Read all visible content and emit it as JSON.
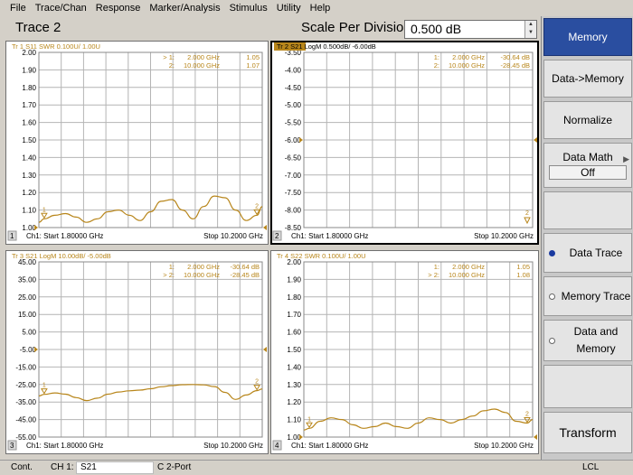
{
  "menu": [
    "File",
    "Trace/Chan",
    "Response",
    "Marker/Analysis",
    "Stimulus",
    "Utility",
    "Help"
  ],
  "header": {
    "title": "Trace 2",
    "scale_label": "Scale Per Division",
    "scale_value": "0.500 dB"
  },
  "softkeys": {
    "memory": "Memory",
    "data_to_memory": "Data->Memory",
    "normalize": "Normalize",
    "data_math": "Data Math",
    "data_math_value": "Off",
    "data_trace": "Data Trace",
    "memory_trace": "Memory Trace",
    "data_and_memory": "Data and Memory",
    "transform": "Transform"
  },
  "status": {
    "mode": "Cont.",
    "channel": "CH 1:",
    "measurement": "S21",
    "cal": "C",
    "port": "2-Port",
    "remote": "LCL"
  },
  "colors": {
    "trace": "#b8861b",
    "grid": "#b4b4b4",
    "softkey_active": "#2a4ea0"
  },
  "panes": [
    {
      "number": "1",
      "trace_label": "Tr  1  S11 SWR 0.100U/  1.00U",
      "markers": [
        {
          "id": "> 1:",
          "freq": "2.000 GHz",
          "value": "1.05"
        },
        {
          "id": "2:",
          "freq": "10.000 GHz",
          "value": "1.07"
        }
      ],
      "y_ticks": [
        "2.00",
        "1.90",
        "1.80",
        "1.70",
        "1.60",
        "1.50",
        "1.40",
        "1.30",
        "1.20",
        "1.10",
        "1.00"
      ],
      "start": "Ch1: Start  1.80000 GHz",
      "stop": "Stop  10.2000 GHz",
      "chart_data": {
        "type": "line",
        "x_range_ghz": [
          1.8,
          10.2
        ],
        "ylim": [
          1.0,
          2.0
        ],
        "ref_value": 1.0,
        "x": [
          1.8,
          2.0,
          2.4,
          2.8,
          3.2,
          3.6,
          4.0,
          4.4,
          4.8,
          5.2,
          5.6,
          6.0,
          6.4,
          6.8,
          7.2,
          7.6,
          8.0,
          8.4,
          8.8,
          9.2,
          9.6,
          10.0,
          10.2
        ],
        "y": [
          1.03,
          1.05,
          1.07,
          1.08,
          1.06,
          1.03,
          1.05,
          1.09,
          1.1,
          1.07,
          1.04,
          1.09,
          1.15,
          1.16,
          1.1,
          1.05,
          1.12,
          1.18,
          1.17,
          1.1,
          1.04,
          1.07,
          1.12
        ]
      }
    },
    {
      "number": "2",
      "trace_label": "Tr  2  S21 LogM 0.500dB/ -6.00dB",
      "markers": [
        {
          "id": "1:",
          "freq": "2.000 GHz",
          "value": "-30.64 dB"
        },
        {
          "id": "2:",
          "freq": "10.000 GHz",
          "value": "-28.45 dB"
        }
      ],
      "y_ticks": [
        "-3.50",
        "-4.00",
        "-4.50",
        "-5.00",
        "-5.50",
        "-6.00",
        "-6.50",
        "-7.00",
        "-7.50",
        "-8.00",
        "-8.50"
      ],
      "start": "Ch1: Start  1.80000 GHz",
      "stop": "Stop  10.2000 GHz",
      "chart_data": {
        "type": "line",
        "x_range_ghz": [
          1.8,
          10.2
        ],
        "ylim": [
          -8.5,
          -3.5
        ],
        "ref_value": -6.0,
        "x": [],
        "y": []
      }
    },
    {
      "number": "3",
      "trace_label": "Tr  3  S21 LogM 10.00dB/ -5.00dB",
      "markers": [
        {
          "id": "1:",
          "freq": "2.000 GHz",
          "value": "-30.64 dB"
        },
        {
          "id": "> 2:",
          "freq": "10.000 GHz",
          "value": "-28.45 dB"
        }
      ],
      "y_ticks": [
        "45.00",
        "35.00",
        "25.00",
        "15.00",
        "5.00",
        "-5.00",
        "-15.00",
        "-25.00",
        "-35.00",
        "-45.00",
        "-55.00"
      ],
      "start": "Ch1: Start  1.80000 GHz",
      "stop": "Stop  10.2000 GHz",
      "chart_data": {
        "type": "line",
        "x_range_ghz": [
          1.8,
          10.2
        ],
        "ylim": [
          -55,
          45
        ],
        "ref_value": -5.0,
        "x": [
          1.8,
          2.0,
          2.4,
          2.8,
          3.2,
          3.6,
          4.0,
          4.4,
          4.8,
          5.2,
          5.6,
          6.0,
          6.4,
          6.8,
          7.2,
          7.6,
          8.0,
          8.4,
          8.8,
          9.2,
          9.6,
          10.0,
          10.2
        ],
        "y": [
          -31.5,
          -30.6,
          -29.8,
          -30.5,
          -32.5,
          -34.2,
          -32.8,
          -30.5,
          -29.3,
          -28.6,
          -28.2,
          -27.4,
          -26.3,
          -25.6,
          -25.1,
          -25.0,
          -25.2,
          -26.2,
          -29.5,
          -33.5,
          -31.0,
          -28.5,
          -27.5
        ]
      }
    },
    {
      "number": "4",
      "trace_label": "Tr  4  S22 SWR 0.100U/  1.00U",
      "markers": [
        {
          "id": "1:",
          "freq": "2.000 GHz",
          "value": "1.05"
        },
        {
          "id": "> 2:",
          "freq": "10.000 GHz",
          "value": "1.08"
        }
      ],
      "y_ticks": [
        "2.00",
        "1.90",
        "1.80",
        "1.70",
        "1.60",
        "1.50",
        "1.40",
        "1.30",
        "1.20",
        "1.10",
        "1.00"
      ],
      "start": "Ch1: Start  1.80000 GHz",
      "stop": "Stop  10.2000 GHz",
      "chart_data": {
        "type": "line",
        "x_range_ghz": [
          1.8,
          10.2
        ],
        "ylim": [
          1.0,
          2.0
        ],
        "ref_value": 1.0,
        "x": [
          1.8,
          2.0,
          2.4,
          2.8,
          3.2,
          3.6,
          4.0,
          4.4,
          4.8,
          5.2,
          5.6,
          6.0,
          6.4,
          6.8,
          7.2,
          7.6,
          8.0,
          8.4,
          8.8,
          9.2,
          9.6,
          10.0,
          10.2
        ],
        "y": [
          1.04,
          1.05,
          1.09,
          1.11,
          1.1,
          1.07,
          1.05,
          1.06,
          1.08,
          1.06,
          1.05,
          1.08,
          1.11,
          1.1,
          1.08,
          1.1,
          1.12,
          1.15,
          1.16,
          1.14,
          1.09,
          1.08,
          1.1
        ]
      }
    }
  ]
}
